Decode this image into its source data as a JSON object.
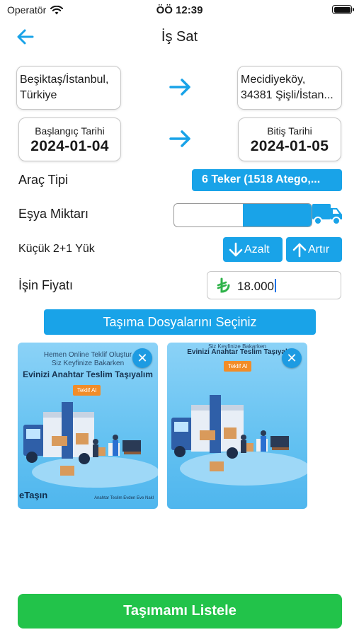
{
  "status_bar": {
    "carrier": "Operatör",
    "time": "ÖÖ 12:39"
  },
  "nav": {
    "title": "İş Sat",
    "back_icon": "arrow-left-icon"
  },
  "route": {
    "from_line1": "Beşiktaş/İstanbul,",
    "from_line2": "Türkiye",
    "to_line1": "Mecidiyeköy,",
    "to_line2": "34381 Şişli/İstan..."
  },
  "dates": {
    "start_label": "Başlangıç Tarihi",
    "start_value": "2024-01-04",
    "end_label": "Bitiş Tarihi",
    "end_value": "2024-01-05"
  },
  "vehicle": {
    "label": "Araç Tipi",
    "value": "6 Teker (1518 Atego,..."
  },
  "quantity": {
    "label": "Eşya Miktarı",
    "level_fraction": 0.5,
    "icon": "truck-icon"
  },
  "load": {
    "label": "Küçük 2+1 Yük",
    "decrease_label": "Azalt",
    "increase_label": "Artır"
  },
  "price": {
    "label": "İşin Fiyatı",
    "currency_icon": "lira-icon",
    "value": "18.000"
  },
  "files_button": "Taşıma Dosyalarını Seçiniz",
  "ads": [
    {
      "head_line1": "Hemen Online Teklif Oluştur",
      "head_line2": "Siz Keyfinize Bakarken",
      "title": "Evinizi Anahtar Teslim Taşıyalım",
      "cta": "Teklif Al",
      "brand": "eTaşın",
      "footer": "Anahtar Teslim Evden Eve Nakl"
    },
    {
      "head_line1": "Siz Keyfinize Bakarken",
      "title": "Evinizi Anahtar Teslim Taşıyal",
      "cta": "Teklif Al"
    }
  ],
  "list_button": "Taşımamı Listele",
  "colors": {
    "accent": "#19a3e8",
    "primary_action": "#22c34a",
    "lira": "#2fb34a"
  }
}
